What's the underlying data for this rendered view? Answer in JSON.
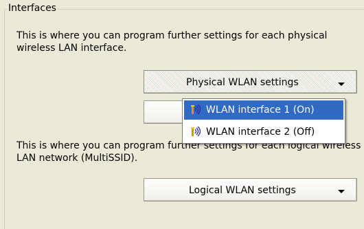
{
  "group": {
    "title": "Interfaces"
  },
  "physical": {
    "description": "This is where you can program further settings for each physical wireless LAN interface.",
    "button_label": "Physical WLAN settings"
  },
  "logical": {
    "description": "This is where you can program further settings for each logical wireless LAN network (MultiSSID).",
    "button_label": "Logical WLAN settings"
  },
  "menu": {
    "items": [
      {
        "label": "WLAN interface 1 (On)",
        "icon": "wlan-antenna-icon",
        "highlighted": true
      },
      {
        "label": "WLAN interface 2 (Off)",
        "icon": "wlan-antenna-icon",
        "highlighted": false
      }
    ]
  },
  "colors": {
    "dialog_bg": "#ece9d8",
    "menu_highlight": "#316ac5"
  }
}
